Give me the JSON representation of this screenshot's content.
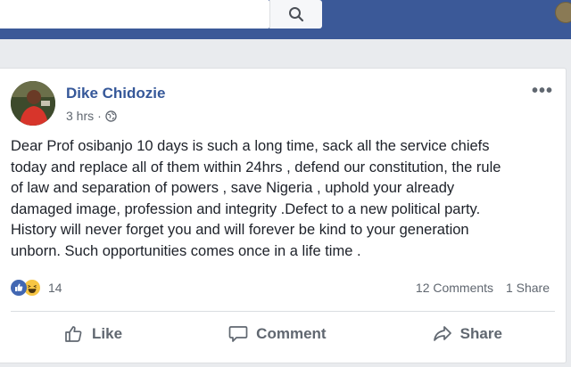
{
  "post": {
    "author": "Dike Chidozie",
    "time": "3 hrs",
    "separator": "·",
    "text": "Dear Prof osibanjo 10 days is such a long time, sack all the service chiefs\ntoday and replace all of them within 24hrs , defend our constitution, the rule\nof law and separation of powers , save Nigeria , uphold your already\ndamaged image, profession and integrity .Defect to a new political party.\nHistory will never forget you and will forever be kind to your generation\nunborn. Such opportunities comes once in a life time .",
    "more_menu": "•••"
  },
  "reactions": {
    "count": "14",
    "icons": [
      "like-reaction-icon",
      "haha-reaction-icon"
    ]
  },
  "stats": {
    "comments": "12 Comments",
    "shares": "1 Share"
  },
  "actions": {
    "like": "Like",
    "comment": "Comment",
    "share": "Share"
  },
  "colors": {
    "topbar": "#3b5998",
    "author_link": "#365899",
    "like_blue": "#4267b2",
    "haha_yellow": "#f7c644"
  }
}
